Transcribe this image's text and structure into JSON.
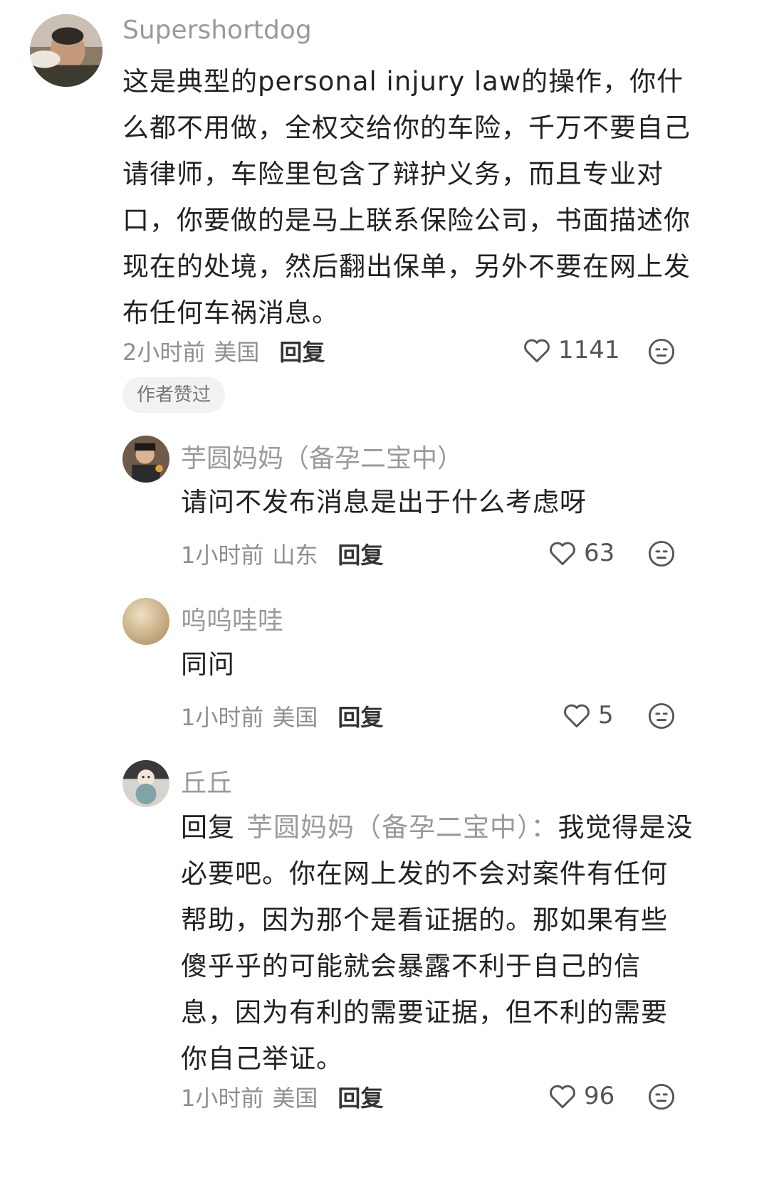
{
  "comments": [
    {
      "username": "Supershortdog",
      "text": "这是典型的personal injury law的操作，你什么都不用做，全权交给你的车险，千万不要自己请律师，车险里包含了辩护义务，而且专业对口，你要做的是马上联系保险公司，书面描述你现在的处境，然后翻出保单，另外不要在网上发布任何车祸消息。",
      "time": "2小时前",
      "location": "美国",
      "reply_label": "回复",
      "likes": "1141",
      "badge": "作者赞过"
    },
    {
      "username": "芋圆妈妈（备孕二宝中）",
      "text": "请问不发布消息是出于什么考虑呀",
      "time": "1小时前",
      "location": "山东",
      "reply_label": "回复",
      "likes": "63"
    },
    {
      "username": "呜呜哇哇",
      "text": "同问",
      "time": "1小时前",
      "location": "美国",
      "reply_label": "回复",
      "likes": "5"
    },
    {
      "username": "丘丘",
      "reply_prefix": "回复",
      "reply_to": "芋圆妈妈（备孕二宝中）：",
      "text": "我觉得是没必要吧。你在网上发的不会对案件有任何帮助，因为那个是看证据的。那如果有些傻乎乎的可能就会暴露不利于自己的信息，因为有利的需要证据，但不利的需要你自己举证。",
      "time": "1小时前",
      "location": "美国",
      "reply_label": "回复",
      "likes": "96"
    }
  ],
  "icons": {
    "like": "heart-outline-icon",
    "dislike": "neutral-face-icon"
  },
  "colors": {
    "text": "#222222",
    "muted": "#9a9a9a",
    "badge_bg": "#f2f2f2"
  }
}
